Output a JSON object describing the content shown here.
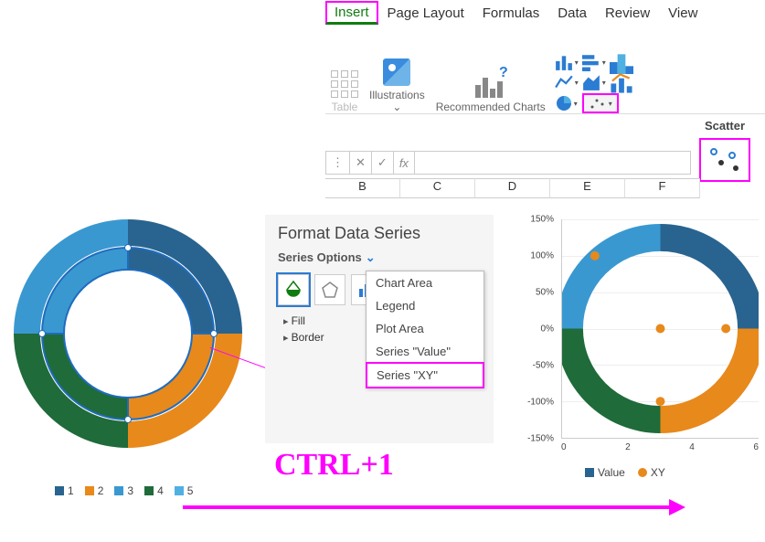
{
  "ribbon": {
    "tabs": [
      "Insert",
      "Page Layout",
      "Formulas",
      "Data",
      "Review",
      "View"
    ],
    "active_tab": "Insert",
    "groups": {
      "table": "Table",
      "illustrations": "Illustrations",
      "recommended": "Recommended Charts"
    },
    "scatter_dropdown_title": "Scatter"
  },
  "formula_bar": {
    "fx": "fx",
    "value": ""
  },
  "columns": [
    "B",
    "C",
    "D",
    "E",
    "F"
  ],
  "donut1": {
    "legend": [
      "1",
      "2",
      "3",
      "4",
      "5"
    ],
    "colors": [
      "#28648f",
      "#e8891b",
      "#3a98d0",
      "#1f6b3a",
      "#4fb0e2"
    ]
  },
  "format_pane": {
    "title": "Format Data Series",
    "section": "Series Options",
    "expanders": [
      "Fill",
      "Border"
    ],
    "dropdown": [
      "Chart Area",
      "Legend",
      "Plot Area",
      "Series \"Value\"",
      "Series \"XY\""
    ]
  },
  "shortcut": "CTRL+1",
  "combo_chart": {
    "y_ticks": [
      "150%",
      "100%",
      "50%",
      "0%",
      "-50%",
      "-100%",
      "-150%"
    ],
    "x_ticks": [
      "0",
      "2",
      "4",
      "6"
    ],
    "legend": [
      "Value",
      "XY"
    ],
    "legend_colors": [
      "#28648f",
      "#e8891b"
    ]
  },
  "chart_data": [
    {
      "type": "pie",
      "title": "Doughnut (outer ring)",
      "categories": [
        "1",
        "2",
        "3",
        "4",
        "5"
      ],
      "values": [
        25,
        25,
        25,
        25,
        0
      ],
      "colors": [
        "#28648f",
        "#3a98d0",
        "#1f6b3a",
        "#e8891b",
        "#4fb0e2"
      ]
    },
    {
      "type": "pie",
      "title": "Doughnut (inner ring)",
      "categories": [
        "1",
        "2",
        "3",
        "4",
        "5"
      ],
      "values": [
        25,
        25,
        25,
        25,
        0
      ],
      "colors": [
        "#28648f",
        "#3a98d0",
        "#1f6b3a",
        "#e8891b",
        "#4fb0e2"
      ]
    },
    {
      "type": "scatter",
      "title": "Series XY overlay",
      "xlabel": "",
      "ylabel": "",
      "xlim": [
        0,
        6
      ],
      "ylim": [
        -150,
        150
      ],
      "series": [
        {
          "name": "XY",
          "x": [
            1,
            3,
            5,
            3
          ],
          "y": [
            100,
            0,
            0,
            -100
          ]
        }
      ]
    }
  ]
}
